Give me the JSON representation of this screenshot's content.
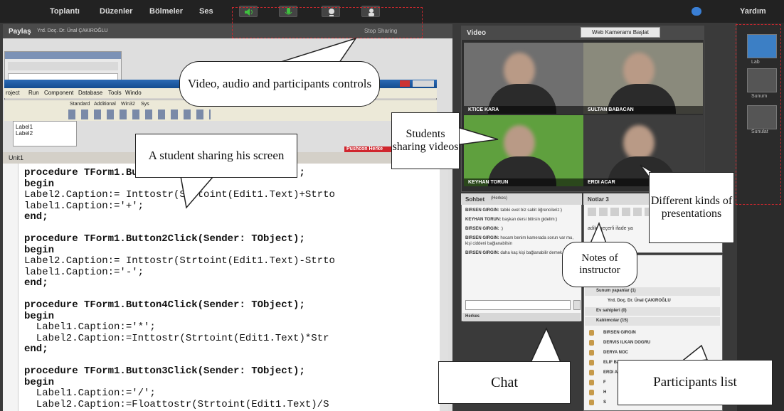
{
  "menu": {
    "items": [
      "Toplantı",
      "Düzenler",
      "Bölmeler",
      "Ses"
    ],
    "help": "Yardım"
  },
  "share": {
    "title": "Paylaş",
    "presenter": "Yrd. Doç. Dr. Ünal ÇAKIROĞLU",
    "stop_button": "Stop Sharing"
  },
  "ide": {
    "menu": [
      "roject",
      "Run",
      "Component",
      "Database",
      "Tools",
      "Windo"
    ],
    "palette_tabs": [
      "Standard",
      "Additional",
      "Win32",
      "Sys"
    ],
    "tree_items": [
      "Label1",
      "Label2"
    ],
    "unit_tab": "Unit1",
    "red_label": "Pushcon Herke",
    "code_lines": [
      "procedure TForm1.Button1Click(Sender: TObject);",
      "begin",
      "Label2.Caption:= Inttostr(Strtoint(Edit1.Text)+Strto",
      "label1.Caption:='+';",
      "end;",
      "",
      "procedure TForm1.Button2Click(Sender: TObject);",
      "begin",
      "Label2.Caption:= Inttostr(Strtoint(Edit1.Text)-Strto",
      "label1.Caption:='-';",
      "end;",
      "",
      "procedure TForm1.Button4Click(Sender: TObject);",
      "begin",
      "  Label1.Caption:='*';",
      "  Label2.Caption:=Inttostr(Strtoint(Edit1.Text)*Str",
      "end;",
      "",
      "procedure TForm1.Button3Click(Sender: TObject);",
      "begin",
      "  Label1.Caption:='/';",
      "  Label2.Caption:=Floattostr(Strtoint(Edit1.Text)/S"
    ]
  },
  "video": {
    "title": "Video",
    "start_button": "Web Kameramı Başlat",
    "tiles": [
      {
        "name": "KTICE KARA",
        "bg": "#6f6f6f"
      },
      {
        "name": "SULTAN BABACAN",
        "bg": "#8a8a7c"
      },
      {
        "name": "KEYHAN TORUN",
        "bg": "#5fa03e"
      },
      {
        "name": "ERDI ACAR",
        "bg": "#3d3d3d"
      }
    ]
  },
  "chat": {
    "title": "Sohbet",
    "subtitle": "(Herkes)",
    "messages": [
      {
        "from": "BIRSEN GIRGIN:",
        "text": "tabiki evet biz sabit öğrencileriz:)"
      },
      {
        "from": "KEYHAN TORUN:",
        "text": "başkan dersi bitirsin gidelim:)"
      },
      {
        "from": "BIRSEN GIRGIN:",
        "text": ":)"
      },
      {
        "from": "BIRSEN GIRGIN:",
        "text": "hocam benim kamerada sorun var mu, kişi ciddeni bağlanabilsin"
      },
      {
        "from": "BIRSEN GIRGIN:",
        "text": "daha kaç kişi bağlanabilir demek mi"
      }
    ],
    "target": "Herkes"
  },
  "notes": {
    "title": "Notlar 3",
    "body": "adile geçerli ifade ya"
  },
  "participants": {
    "presenters": "Sunum yapanlar (1)",
    "presenter_name": "Yrd. Doç. Dr. Ünal ÇAKIROĞLU",
    "hosts": "Ev sahipleri (0)",
    "attendees": "Katılımcılar (15)",
    "list": [
      "BIRSEN GIRGIN",
      "DERVIS ILKAN DOGRU",
      "DERYA NOC",
      "ELIF BAHADIR",
      "ERDI ACAR",
      "F",
      "H",
      "S"
    ]
  },
  "layouts": {
    "items": [
      "Lab",
      "Sunum",
      "Sunulat"
    ]
  },
  "callouts": {
    "controls": "Video, audio and participants controls",
    "student_screen": "A student sharing his screen",
    "students_videos": "Students sharing videos",
    "presentations": "Different kinds of presentations",
    "notes": "Notes of instructor",
    "chat": "Chat",
    "participants": "Participants list"
  },
  "colors": {
    "callout_border": "#222222",
    "dash": "#c8282e",
    "chrome": "#2b2b2b"
  }
}
